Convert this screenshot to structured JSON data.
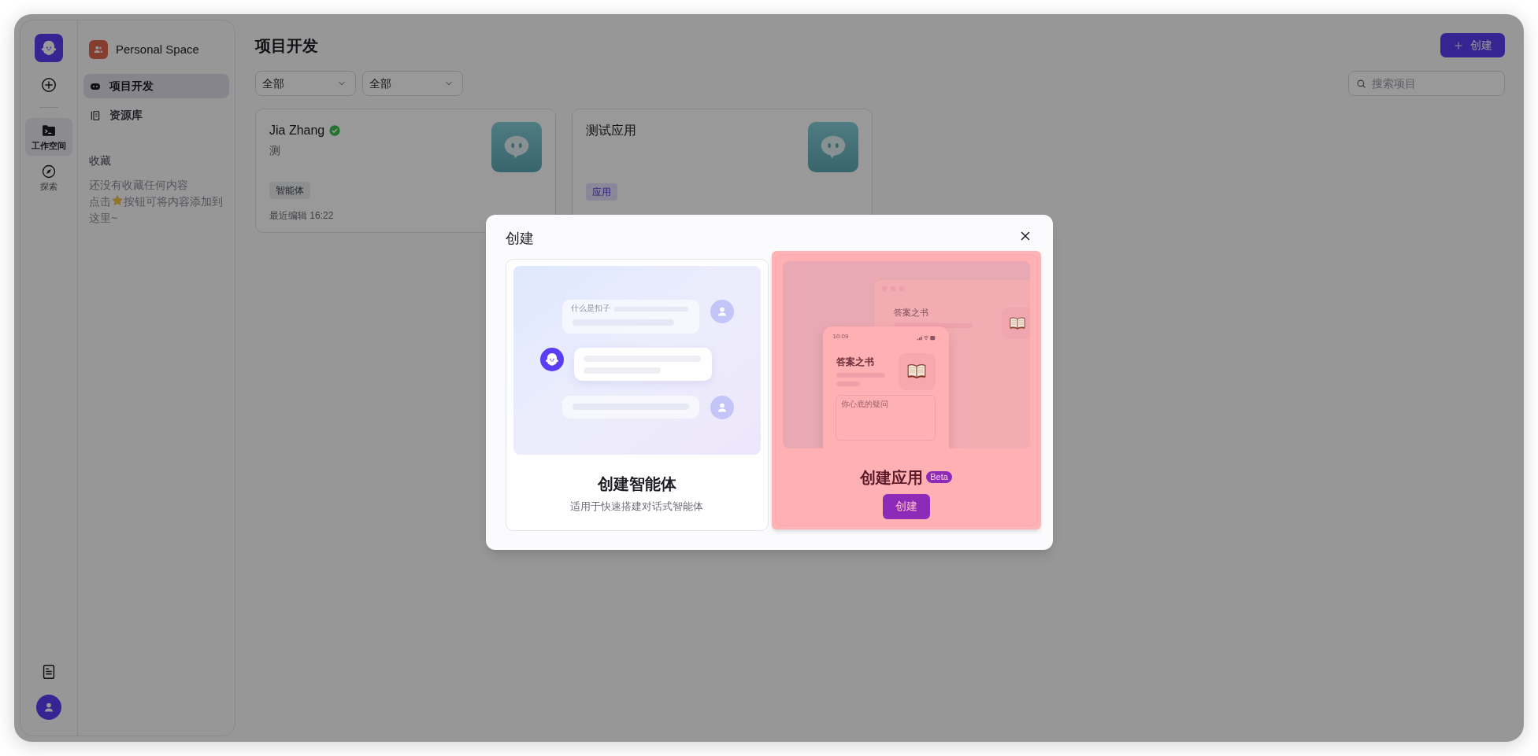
{
  "rail": {
    "items": [
      {
        "label": "工作空间",
        "selected": true
      },
      {
        "label": "探索",
        "selected": false
      }
    ]
  },
  "space": {
    "name": "Personal Space"
  },
  "nav": [
    {
      "label": "项目开发",
      "selected": true
    },
    {
      "label": "资源库",
      "selected": false
    }
  ],
  "favorites": {
    "heading": "收藏",
    "empty_text": "还没有收藏任何内容",
    "hint_before": "点击",
    "hint_after": "按钮可将内容添加到这里~"
  },
  "page": {
    "title": "项目开发",
    "create_button": "创建",
    "filters": [
      "全部",
      "全部"
    ],
    "search": {
      "placeholder": "搜索项目"
    }
  },
  "projects": [
    {
      "name": "Jia Zhang",
      "verified": true,
      "description": "测",
      "tag": {
        "label": "智能体",
        "kind": "agent"
      },
      "edited": "最近编辑 16:22"
    },
    {
      "name": "测试应用",
      "verified": false,
      "tag": {
        "label": "应用",
        "kind": "app"
      }
    }
  ],
  "dialog": {
    "title": "创建",
    "options": [
      {
        "kind": "agent",
        "highlighted": false,
        "title": "创建智能体",
        "description": "适用于快速搭建对话式智能体",
        "preview": {
          "question": "什么是扣子"
        }
      },
      {
        "kind": "app",
        "highlighted": true,
        "title": "创建应用",
        "badge": "Beta",
        "button": "创建",
        "preview": {
          "back_title": "答案之书",
          "time": "10:09",
          "app_title": "答案之书",
          "input_placeholder": "你心底的疑问"
        }
      }
    ]
  }
}
